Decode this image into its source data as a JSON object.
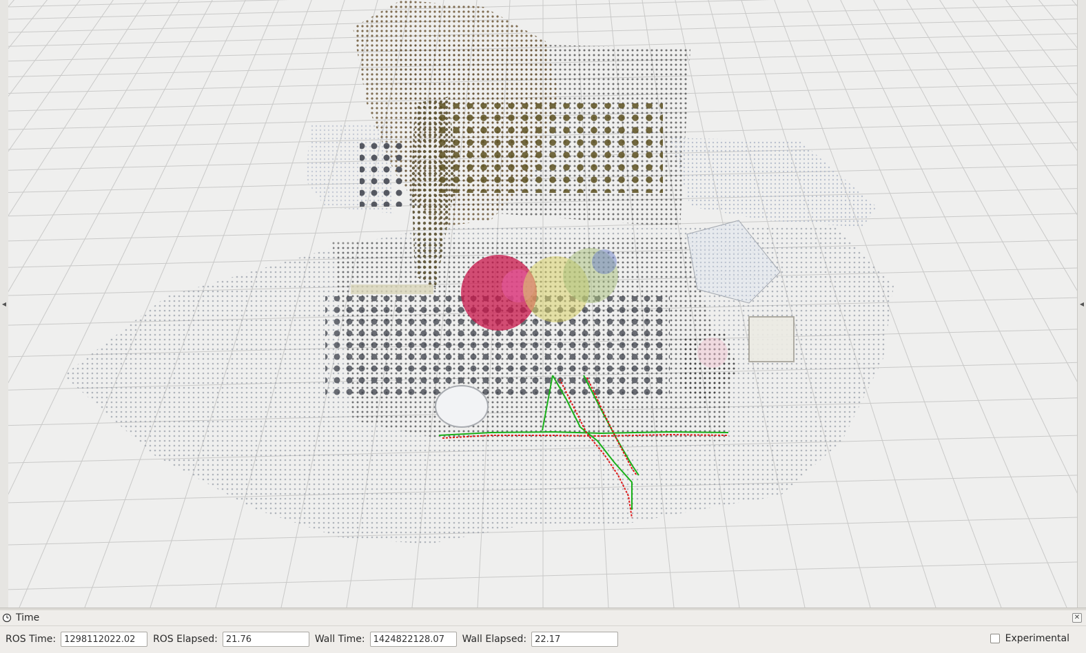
{
  "time_panel": {
    "title": "Time",
    "ros_time_label": "ROS Time:",
    "ros_time_value": "1298112022.02",
    "ros_elapsed_label": "ROS Elapsed:",
    "ros_elapsed_value": "21.76",
    "wall_time_label": "Wall Time:",
    "wall_time_value": "1424822128.07",
    "wall_elapsed_label": "Wall Elapsed:",
    "wall_elapsed_value": "22.17",
    "experimental_label": "Experimental",
    "experimental_checked": false
  },
  "viewport": {
    "background_color": "#efefee",
    "grid_color": "#c9c9c8",
    "trajectory_colors": [
      "#e01818",
      "#18b018"
    ]
  },
  "icons": {
    "panel_icon": "clock-icon",
    "close": "close-icon",
    "left_handle": "arrow-left-icon",
    "right_handle": "arrow-right-icon"
  }
}
